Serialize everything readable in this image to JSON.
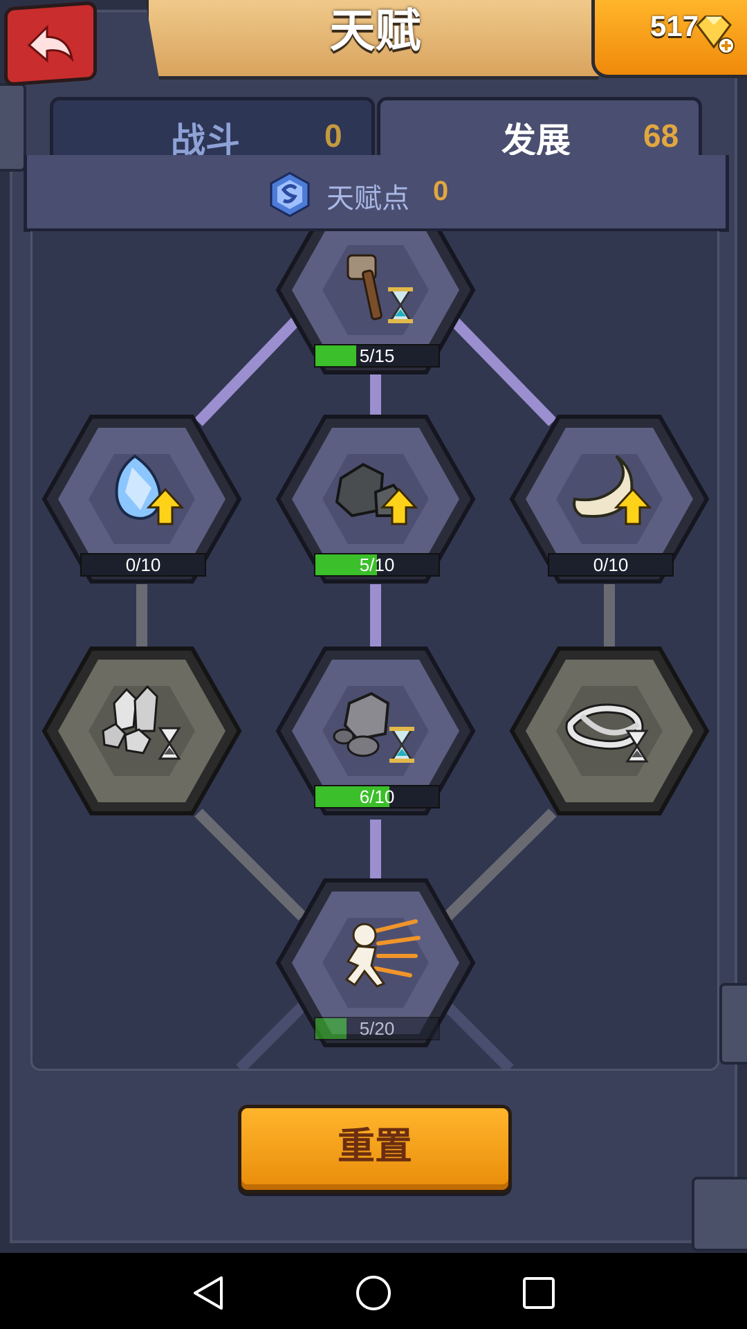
{
  "header": {
    "title": "天赋",
    "gems": "517"
  },
  "tabs": [
    {
      "label": "战斗",
      "value": "0"
    },
    {
      "label": "发展",
      "value": "68"
    }
  ],
  "talent_points": {
    "label": "天赋点",
    "value": "0"
  },
  "nodes": [
    {
      "id": "top",
      "icon": "hammer-hourglass-icon",
      "progress": "5/15",
      "fraction": 0.333
    },
    {
      "id": "row1-left",
      "icon": "crystal-upgrade-icon",
      "progress": "0/10",
      "fraction": 0
    },
    {
      "id": "row1-mid",
      "icon": "stone-upgrade-icon",
      "progress": "5/10",
      "fraction": 0.5
    },
    {
      "id": "row1-right",
      "icon": "bone-upgrade-icon",
      "progress": "0/10",
      "fraction": 0
    },
    {
      "id": "row2-left",
      "icon": "crystal-hourglass-icon",
      "progress": "",
      "fraction": 0,
      "locked": true
    },
    {
      "id": "row2-mid",
      "icon": "stone-hourglass-icon",
      "progress": "6/10",
      "fraction": 0.6
    },
    {
      "id": "row2-right",
      "icon": "bone-hourglass-icon",
      "progress": "",
      "fraction": 0,
      "locked": true
    },
    {
      "id": "bottom",
      "icon": "running-speed-icon",
      "progress": "5/20",
      "fraction": 0.25
    }
  ],
  "reset_label": "重置",
  "colors": {
    "active_link": "#9b8fd0",
    "inactive_link": "#6a6b72",
    "progress_fill": "#3bbf2a",
    "accent_orange": "#f3a11a"
  }
}
